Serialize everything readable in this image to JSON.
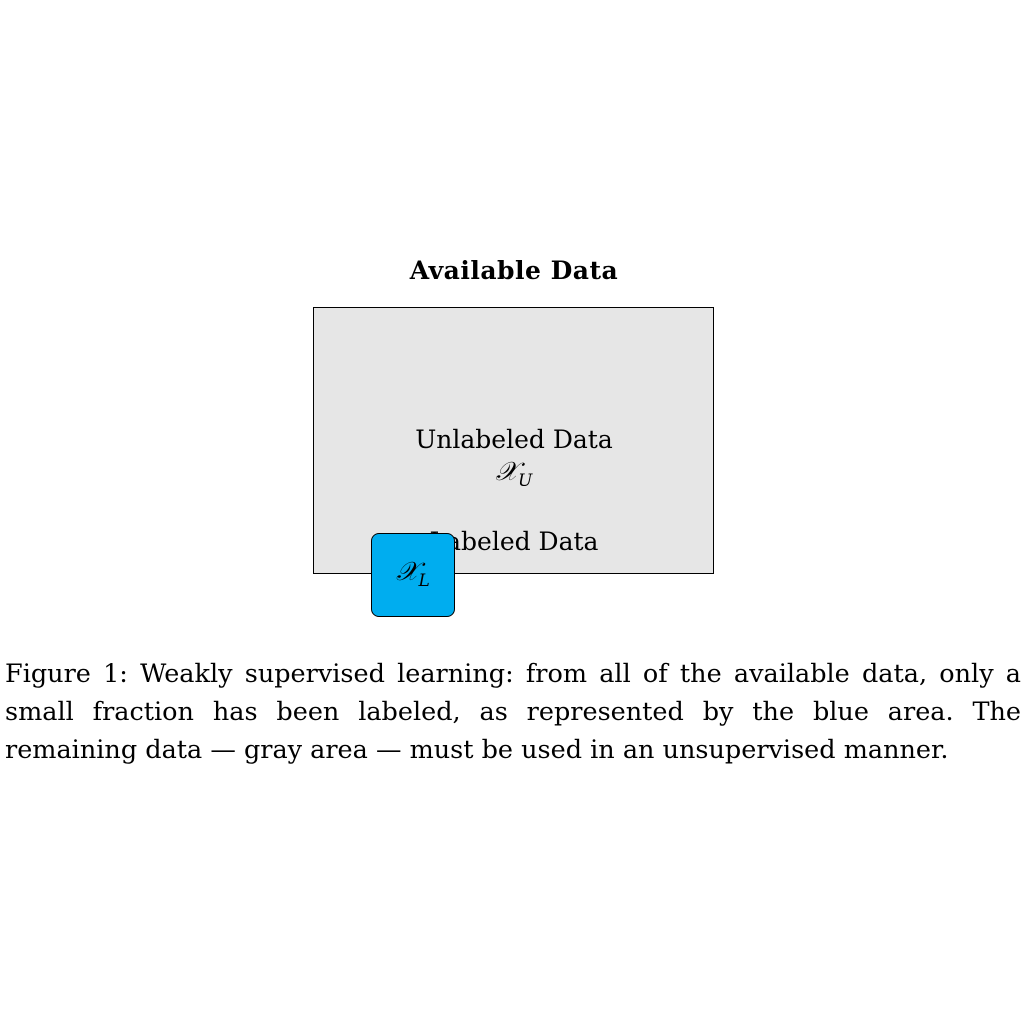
{
  "figure": {
    "title": "Available Data",
    "unlabeled": {
      "label": "Unlabeled Data",
      "symbol": "𝒳",
      "subscript": "U"
    },
    "labeled": {
      "label": "Labeled Data",
      "symbol": "𝒳",
      "subscript": "L"
    },
    "colors": {
      "unlabeled_area": "#e6e6e6",
      "labeled_area": "#00adef"
    }
  },
  "caption": "Figure 1:  Weakly supervised learning:  from all of the available data, only a small fraction has been labeled, as represented by the blue area. The remaining data — gray area — must be used in an unsupervised manner."
}
